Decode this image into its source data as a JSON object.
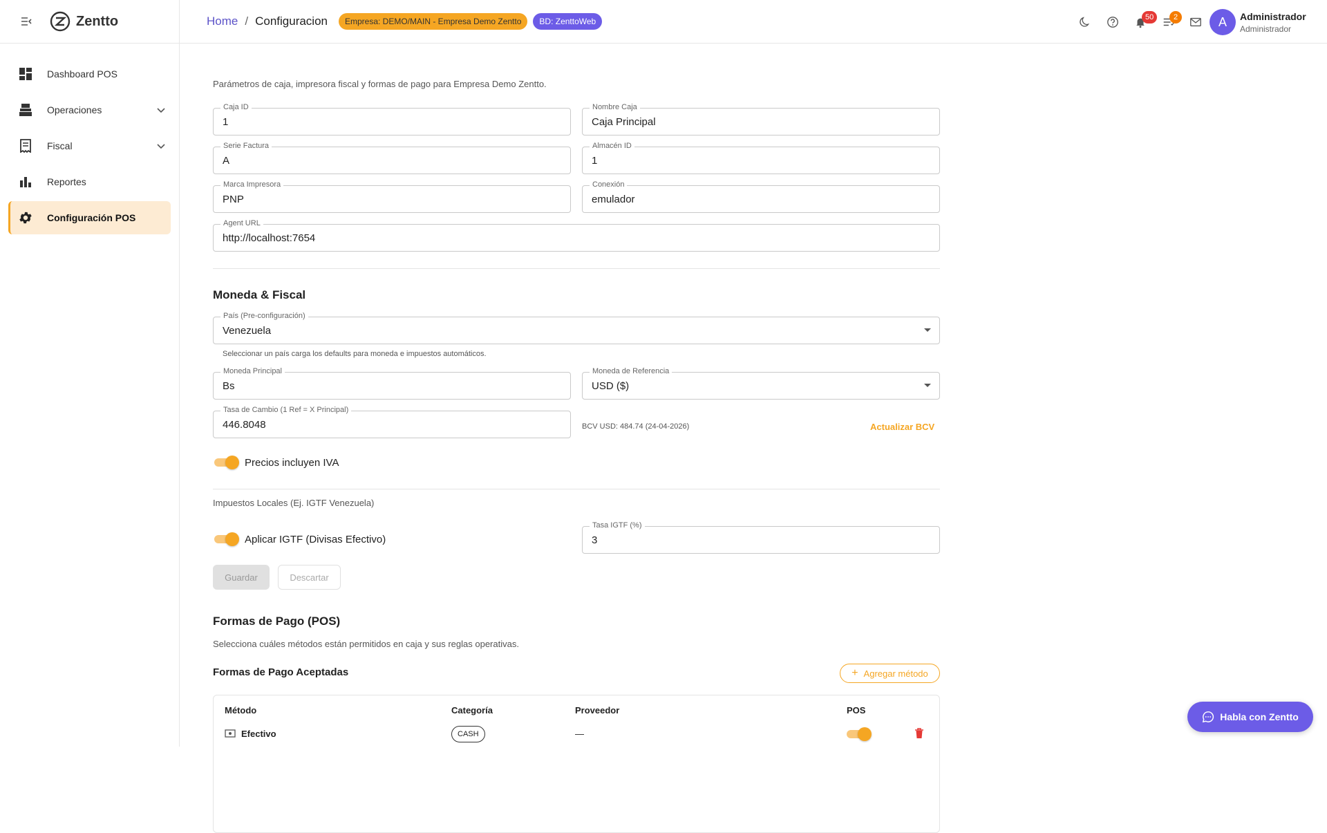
{
  "app": {
    "name": "Zentto"
  },
  "sidebar": {
    "items": [
      {
        "label": "Dashboard POS",
        "icon": "dashboard-icon"
      },
      {
        "label": "Operaciones",
        "icon": "cash-register-icon"
      },
      {
        "label": "Fiscal",
        "icon": "receipt-icon"
      },
      {
        "label": "Reportes",
        "icon": "bar-chart-icon"
      },
      {
        "label": "Configuración POS",
        "icon": "gear-icon"
      }
    ]
  },
  "topbar": {
    "breadcrumb": {
      "home": "Home",
      "separator": "/",
      "current": "Configuracion"
    },
    "company_chip": "Empresa: DEMO/MAIN - Empresa Demo Zentto",
    "db_chip": "BD: ZenttoWeb",
    "notifications_count": "50",
    "tasks_count": "2",
    "user": {
      "initial": "A",
      "name": "Administrador",
      "role": "Administrador"
    }
  },
  "colors": {
    "accent": "#f5a623",
    "primary": "#6c5ce7",
    "link": "#5c53c8"
  },
  "main": {
    "intro": "Parámetros de caja, impresora fiscal y formas de pago para Empresa Demo Zentto.",
    "fields": {
      "caja_id": {
        "label": "Caja ID",
        "value": "1"
      },
      "nombre_caja": {
        "label": "Nombre Caja",
        "value": "Caja Principal"
      },
      "serie_factura": {
        "label": "Serie Factura",
        "value": "A"
      },
      "almacen_id": {
        "label": "Almacén ID",
        "value": "1"
      },
      "marca_impresora": {
        "label": "Marca Impresora",
        "value": "PNP"
      },
      "conexion": {
        "label": "Conexión",
        "value": "emulador"
      },
      "agent_url": {
        "label": "Agent URL",
        "value": "http://localhost:7654"
      }
    },
    "moneda": {
      "title": "Moneda & Fiscal",
      "pais": {
        "label": "País (Pre-configuración)",
        "value": "Venezuela"
      },
      "pais_helper": "Seleccionar un país carga los defaults para moneda e impuestos automáticos.",
      "moneda_principal": {
        "label": "Moneda Principal",
        "value": "Bs"
      },
      "moneda_referencia": {
        "label": "Moneda de Referencia",
        "value": "USD ($)"
      },
      "tasa_cambio": {
        "label": "Tasa de Cambio (1 Ref = X Principal)",
        "value": "446.8048"
      },
      "bcv_info": "BCV USD: 484.74 (24-04-2026)",
      "actualizar_bcv": "Actualizar BCV",
      "precios_iva_label": "Precios incluyen IVA",
      "precios_iva_on": true,
      "impuestos_locales": "Impuestos Locales (Ej. IGTF Venezuela)",
      "igtf_label": "Aplicar IGTF (Divisas Efectivo)",
      "igtf_on": true,
      "tasa_igtf": {
        "label": "Tasa IGTF (%)",
        "value": "3"
      },
      "guardar": "Guardar",
      "descartar": "Descartar"
    },
    "pagos": {
      "title": "Formas de Pago (POS)",
      "subtitle": "Selecciona cuáles métodos están permitidos en caja y sus reglas operativas.",
      "aceptadas_title": "Formas de Pago Aceptadas",
      "agregar": "Agregar método",
      "columns": [
        "Método",
        "Categoría",
        "Proveedor",
        "POS"
      ],
      "rows": [
        {
          "metodo": "Efectivo",
          "categoria": "CASH",
          "proveedor": "—",
          "pos_on": true
        }
      ]
    }
  },
  "chat": {
    "label": "Habla con Zentto"
  }
}
